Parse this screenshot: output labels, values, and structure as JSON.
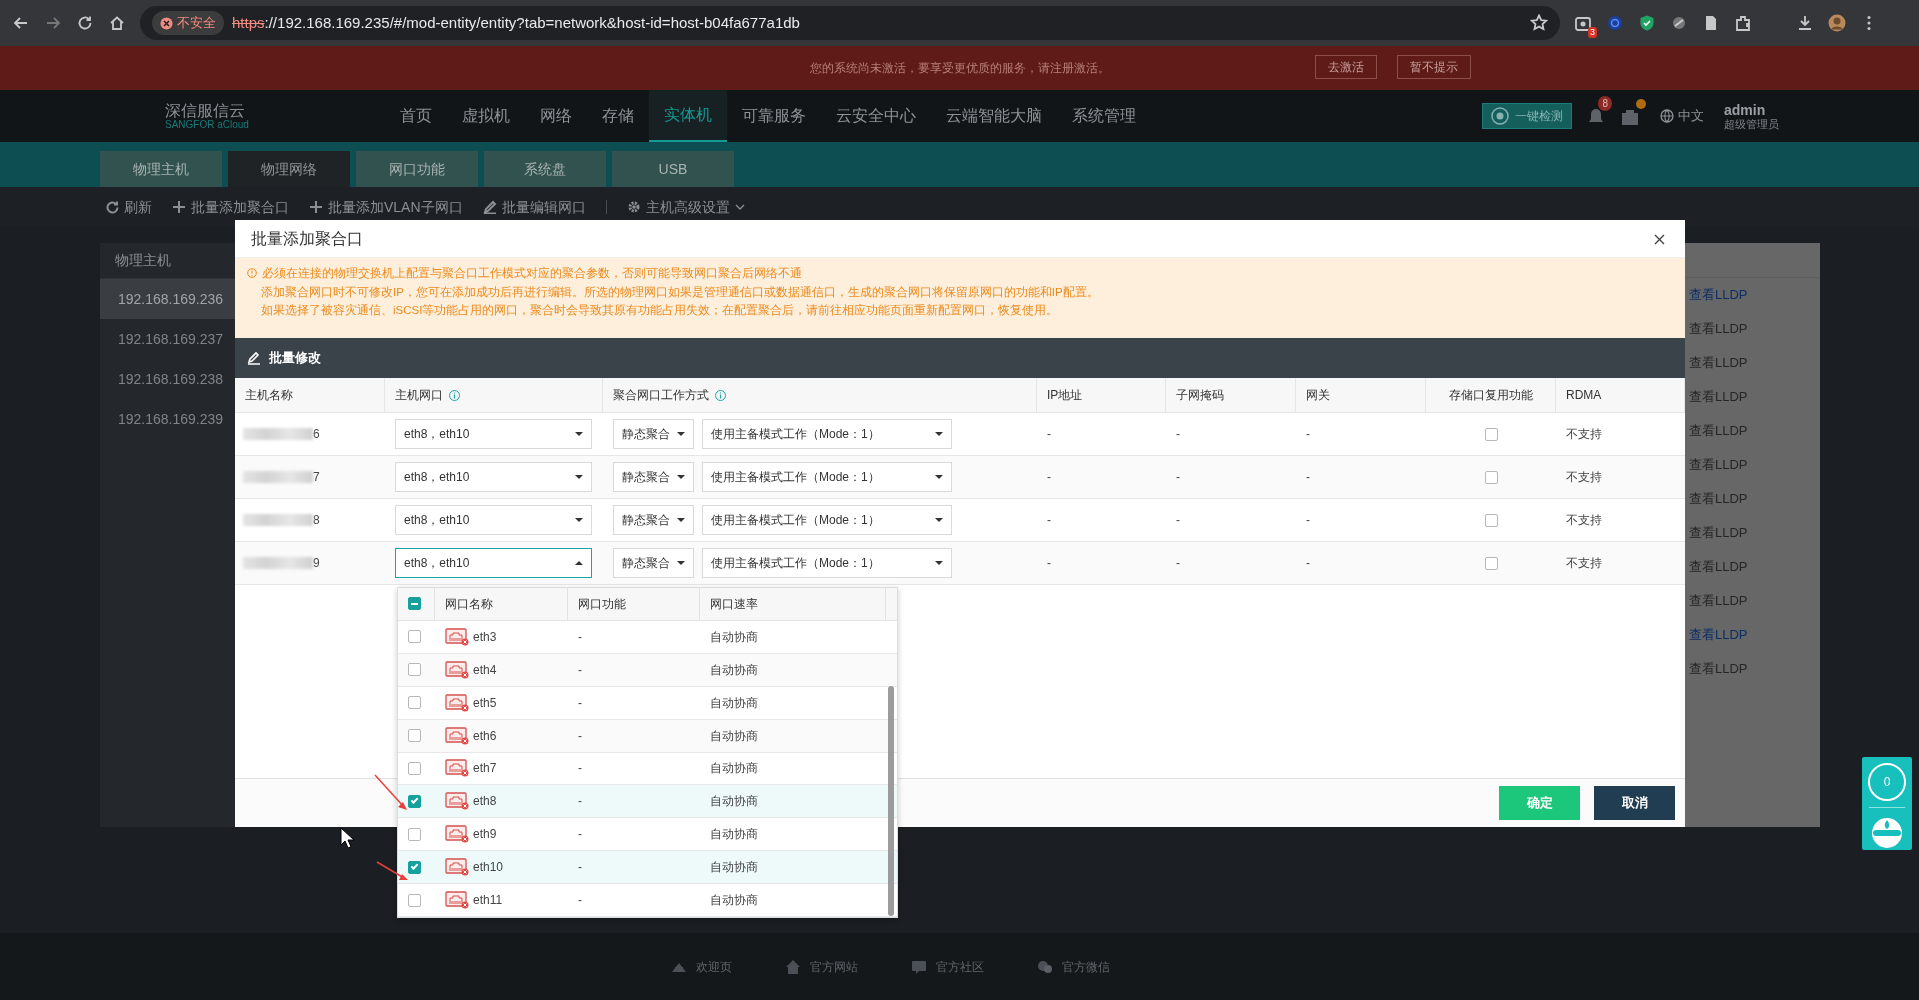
{
  "browser": {
    "security": "不安全",
    "url_scheme": "https",
    "url_rest": "://192.168.169.235/#/mod-entity/entity?tab=network&host-id=host-b04fa677a1db",
    "extension_badge": "3"
  },
  "banner": {
    "message": "您的系统尚未激活，要享受更优质的服务，请注册激活。",
    "buttons": [
      "去激活",
      "暂不提示"
    ]
  },
  "header": {
    "logo": "深信服信云",
    "logo_sub": "SANGFOR aCloud",
    "nav": [
      {
        "label": "首页",
        "selected": false
      },
      {
        "label": "虚拟机",
        "selected": false
      },
      {
        "label": "网络",
        "selected": false
      },
      {
        "label": "存储",
        "selected": false
      },
      {
        "label": "实体机",
        "selected": true
      },
      {
        "label": "可靠服务",
        "selected": false
      },
      {
        "label": "云安全中心",
        "selected": false
      },
      {
        "label": "云端智能大脑",
        "selected": false
      },
      {
        "label": "系统管理",
        "selected": false
      }
    ],
    "check_button": "一键检测",
    "notification_count": "8",
    "language": "中文",
    "user": "admin",
    "role": "超级管理员"
  },
  "tabs": [
    {
      "label": "物理主机",
      "selected": false
    },
    {
      "label": "物理网络",
      "selected": true
    },
    {
      "label": "网口功能",
      "selected": false
    },
    {
      "label": "系统盘",
      "selected": false
    },
    {
      "label": "USB",
      "selected": false
    }
  ],
  "toolbar": [
    {
      "label": "刷新",
      "kind": "refresh"
    },
    {
      "label": "批量添加聚合口",
      "kind": "add"
    },
    {
      "label": "批量添加VLAN子网口",
      "kind": "add"
    },
    {
      "label": "批量编辑网口",
      "kind": "edit"
    },
    {
      "label": "主机高级设置",
      "kind": "settings"
    }
  ],
  "sidebar": {
    "title": "物理主机",
    "items": [
      {
        "label": "192.168.169.236",
        "selected": true
      },
      {
        "label": "192.168.169.237",
        "selected": false
      },
      {
        "label": "192.168.169.238",
        "selected": false
      },
      {
        "label": "192.168.169.239",
        "selected": false
      }
    ]
  },
  "lldp_links": [
    {
      "label": "查看LLDP",
      "emphasized": true
    },
    {
      "label": "查看LLDP",
      "emphasized": false
    },
    {
      "label": "查看LLDP",
      "emphasized": false
    },
    {
      "label": "查看LLDP",
      "emphasized": false
    },
    {
      "label": "查看LLDP",
      "emphasized": false
    },
    {
      "label": "查看LLDP",
      "emphasized": false
    },
    {
      "label": "查看LLDP",
      "emphasized": false
    },
    {
      "label": "查看LLDP",
      "emphasized": false
    },
    {
      "label": "查看LLDP",
      "emphasized": false
    },
    {
      "label": "查看LLDP",
      "emphasized": false
    },
    {
      "label": "查看LLDP",
      "emphasized": true
    },
    {
      "label": "查看LLDP",
      "emphasized": false
    }
  ],
  "modal": {
    "title": "批量添加聚合口",
    "warnings": [
      "必须在连接的物理交换机上配置与聚合口工作模式对应的聚合参数，否则可能导致网口聚合后网络不通",
      "添加聚合网口时不可修改IP，您可在添加成功后再进行编辑。所选的物理网口如果是管理通信口或数据通信口，生成的聚合网口将保留原网口的功能和IP配置。",
      "如果选择了被容灾通信、iSCSI等功能占用的网口，聚合时会导致其原有功能占用失效；在配置聚合后，请前往相应功能页面重新配置网口，恢复使用。"
    ],
    "batch_edit": "批量修改",
    "columns": [
      {
        "label": "主机名称",
        "info": false
      },
      {
        "label": "主机网口",
        "info": true
      },
      {
        "label": "聚合网口工作方式",
        "info": true
      },
      {
        "label": "IP地址",
        "info": false
      },
      {
        "label": "子网掩码",
        "info": false
      },
      {
        "label": "网关",
        "info": false
      },
      {
        "label": "存储口复用功能",
        "info": false
      },
      {
        "label": "RDMA",
        "info": false
      }
    ],
    "rows": [
      {
        "host": "6",
        "ports": "eth8，eth10",
        "open": false,
        "agg_mode": "静态聚合",
        "work_mode": "使用主备模式工作（Mode：1）",
        "ip": "-",
        "mask": "-",
        "gateway": "-",
        "storage_reuse": false,
        "rdma": "不支持"
      },
      {
        "host": "7",
        "ports": "eth8，eth10",
        "open": false,
        "agg_mode": "静态聚合",
        "work_mode": "使用主备模式工作（Mode：1）",
        "ip": "-",
        "mask": "-",
        "gateway": "-",
        "storage_reuse": false,
        "rdma": "不支持"
      },
      {
        "host": "8",
        "ports": "eth8，eth10",
        "open": false,
        "agg_mode": "静态聚合",
        "work_mode": "使用主备模式工作（Mode：1）",
        "ip": "-",
        "mask": "-",
        "gateway": "-",
        "storage_reuse": false,
        "rdma": "不支持"
      },
      {
        "host": "9",
        "ports": "eth8，eth10",
        "open": true,
        "agg_mode": "静态聚合",
        "work_mode": "使用主备模式工作（Mode：1）",
        "ip": "-",
        "mask": "-",
        "gateway": "-",
        "storage_reuse": false,
        "rdma": "不支持"
      }
    ],
    "buttons": [
      {
        "label": "确定",
        "kind": "primary"
      },
      {
        "label": "取消",
        "kind": "secondary"
      }
    ]
  },
  "port_dropdown": {
    "indeterminate": true,
    "columns": [
      "网口名称",
      "网口功能",
      "网口速率"
    ],
    "rows": [
      {
        "name": "eth3",
        "function": "-",
        "speed": "自动协商",
        "checked": false
      },
      {
        "name": "eth4",
        "function": "-",
        "speed": "自动协商",
        "checked": false
      },
      {
        "name": "eth5",
        "function": "-",
        "speed": "自动协商",
        "checked": false
      },
      {
        "name": "eth6",
        "function": "-",
        "speed": "自动协商",
        "checked": false
      },
      {
        "name": "eth7",
        "function": "-",
        "speed": "自动协商",
        "checked": false
      },
      {
        "name": "eth8",
        "function": "-",
        "speed": "自动协商",
        "checked": true
      },
      {
        "name": "eth9",
        "function": "-",
        "speed": "自动协商",
        "checked": false
      },
      {
        "name": "eth10",
        "function": "-",
        "speed": "自动协商",
        "checked": true
      },
      {
        "name": "eth11",
        "function": "-",
        "speed": "自动协商",
        "checked": false
      }
    ]
  },
  "float_widget": {
    "count": "0"
  },
  "footer_links": [
    "欢迎页",
    "官方网站",
    "官方社区",
    "官方微信"
  ]
}
